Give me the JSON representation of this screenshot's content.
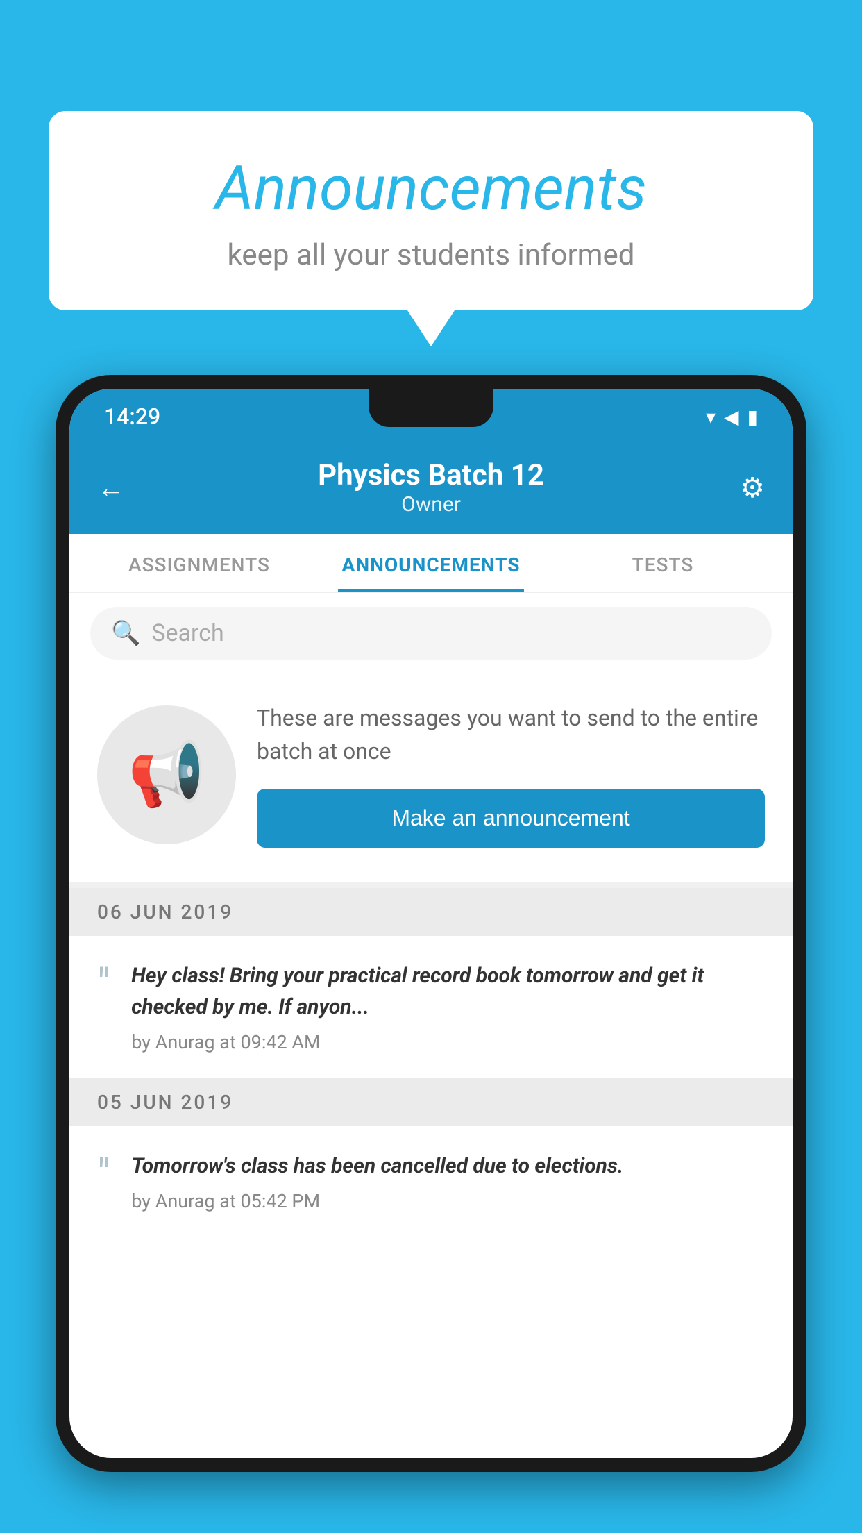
{
  "background_color": "#29B6E8",
  "speech_bubble": {
    "title": "Announcements",
    "subtitle": "keep all your students informed"
  },
  "status_bar": {
    "time": "14:29",
    "wifi": "▾",
    "signal": "▲",
    "battery": "▮"
  },
  "header": {
    "title": "Physics Batch 12",
    "subtitle": "Owner",
    "back_label": "←",
    "settings_label": "⚙"
  },
  "tabs": [
    {
      "label": "ASSIGNMENTS",
      "active": false
    },
    {
      "label": "ANNOUNCEMENTS",
      "active": true
    },
    {
      "label": "TESTS",
      "active": false
    }
  ],
  "search": {
    "placeholder": "Search"
  },
  "promo": {
    "description": "These are messages you want to send to the entire batch at once",
    "button_label": "Make an announcement"
  },
  "announcements": [
    {
      "date": "06  JUN  2019",
      "text": "Hey class! Bring your practical record book tomorrow and get it checked by me. If anyon...",
      "meta": "by Anurag at 09:42 AM"
    },
    {
      "date": "05  JUN  2019",
      "text": "Tomorrow's class has been cancelled due to elections.",
      "meta": "by Anurag at 05:42 PM"
    }
  ]
}
